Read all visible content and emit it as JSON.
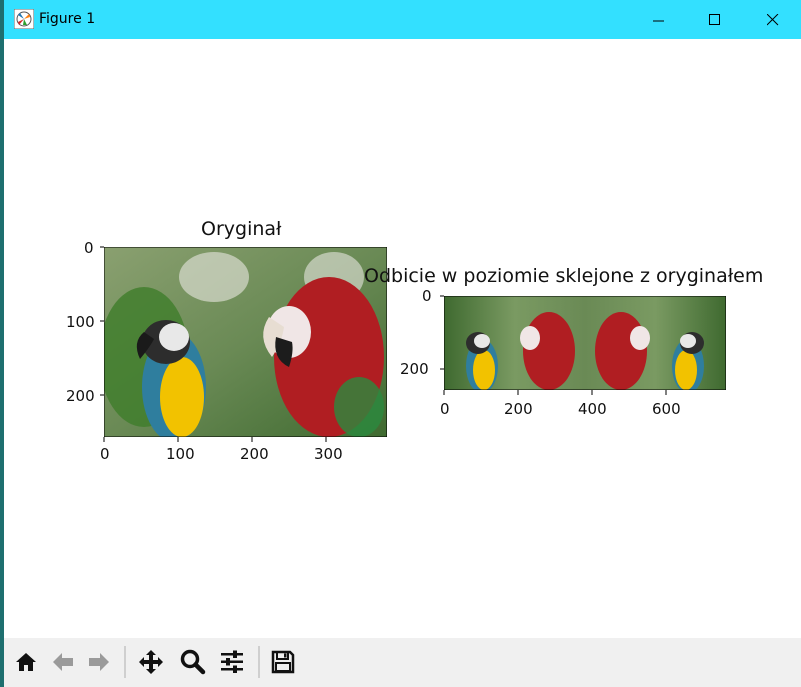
{
  "window": {
    "title": "Figure 1",
    "controls": {
      "minimize": "minimize-icon",
      "maximize": "maximize-icon",
      "close": "close-icon"
    }
  },
  "figure": {
    "axes": [
      {
        "title": "Oryginał",
        "xticks": [
          "0",
          "100",
          "200",
          "300"
        ],
        "yticks": [
          "0",
          "100",
          "200"
        ]
      },
      {
        "title": "Odbicie w poziomie sklejone z oryginałem",
        "xticks": [
          "0",
          "200",
          "400",
          "600"
        ],
        "yticks": [
          "0",
          "200"
        ]
      }
    ]
  },
  "toolbar": {
    "buttons": [
      {
        "name": "home",
        "icon": "home-icon"
      },
      {
        "name": "back",
        "icon": "arrow-left-icon"
      },
      {
        "name": "forward",
        "icon": "arrow-right-icon"
      },
      {
        "name": "pan",
        "icon": "move-icon"
      },
      {
        "name": "zoom",
        "icon": "magnifier-icon"
      },
      {
        "name": "configure-subplots",
        "icon": "sliders-icon"
      },
      {
        "name": "save",
        "icon": "floppy-disk-icon"
      }
    ]
  },
  "colors": {
    "titlebar": "#33e0ff",
    "toolbar": "#f0f0f0",
    "parrot_red": "#b01e22",
    "parrot_yellow": "#f2c200",
    "foliage": "#4f8a3a"
  }
}
